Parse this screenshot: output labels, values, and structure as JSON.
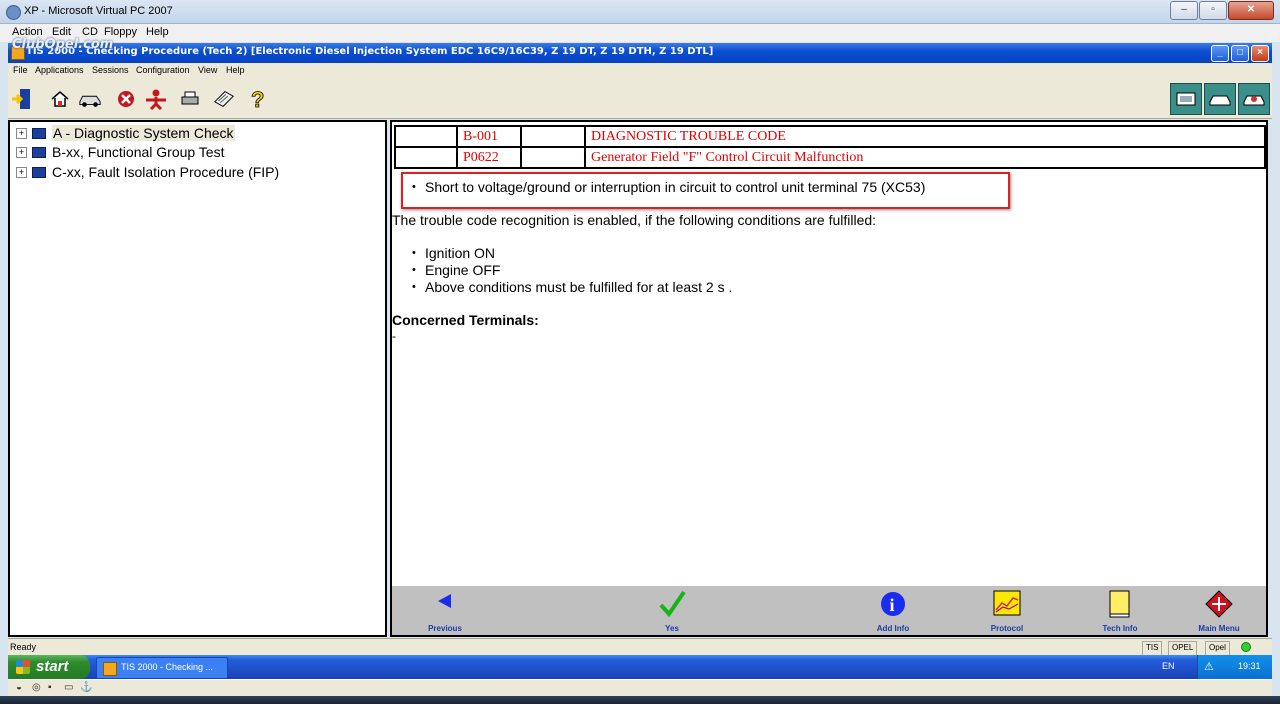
{
  "host": {
    "title": "XP - Microsoft Virtual PC 2007",
    "menu": [
      "Action",
      "Edit",
      "CD",
      "Floppy",
      "Help"
    ]
  },
  "watermark": "ClubOpel.com",
  "app": {
    "title": "TIS 2000 - Checking Procedure (Tech 2) [Electronic Diesel Injection System EDC 16C9/16C39, Z 19 DT, Z 19 DTH, Z 19 DTL]",
    "menu": [
      "File",
      "Applications",
      "Sessions",
      "Configuration",
      "View",
      "Help"
    ]
  },
  "toolbar_icons": [
    "exit-icon",
    "home-icon",
    "vehicle-icon",
    "cancel-icon",
    "person-icon",
    "print-icon",
    "notepad-icon",
    "help-icon"
  ],
  "tree": {
    "items": [
      {
        "label": "A - Diagnostic System Check",
        "selected": true
      },
      {
        "label": "B-xx, Functional Group Test",
        "selected": false
      },
      {
        "label": "C-xx, Fault Isolation Procedure (FIP)",
        "selected": false
      }
    ]
  },
  "dtc_table": {
    "rows": [
      {
        "code": "B-001",
        "blank": "",
        "text": "DIAGNOSTIC TROUBLE CODE"
      },
      {
        "code": "P0622",
        "blank": "",
        "text": "Generator Field \"F\" Control Circuit Malfunction"
      }
    ]
  },
  "content": {
    "highlight_bullet": "Short to voltage/ground or interruption in circuit to control unit terminal 75 (XC53)",
    "conditions_intro": "The trouble code recognition is enabled, if the following conditions are fulfilled:",
    "conditions": [
      "Ignition ON",
      "Engine OFF",
      "Above conditions must be fulfilled for at least 2 s ."
    ],
    "terminals_heading": "Concerned Terminals:",
    "terminals_value": "-"
  },
  "nav_buttons": {
    "previous": "Previous",
    "yes": "Yes",
    "add_info": "Add Info",
    "protocol": "Protocol",
    "tech_info": "Tech Info",
    "main_menu": "Main Menu"
  },
  "status": {
    "text": "Ready",
    "cells": [
      "TIS",
      "OPEL",
      "Opel"
    ]
  },
  "taskbar": {
    "start": "start",
    "task_item": "TIS 2000 - Checking ...",
    "language": "EN",
    "clock": "19:31"
  },
  "colors": {
    "dtc_red": "#e30000",
    "highlight_red": "#d9231f",
    "nav_label_blue": "#1a3ca8",
    "xp_title_blue": "#0a4fd0"
  }
}
